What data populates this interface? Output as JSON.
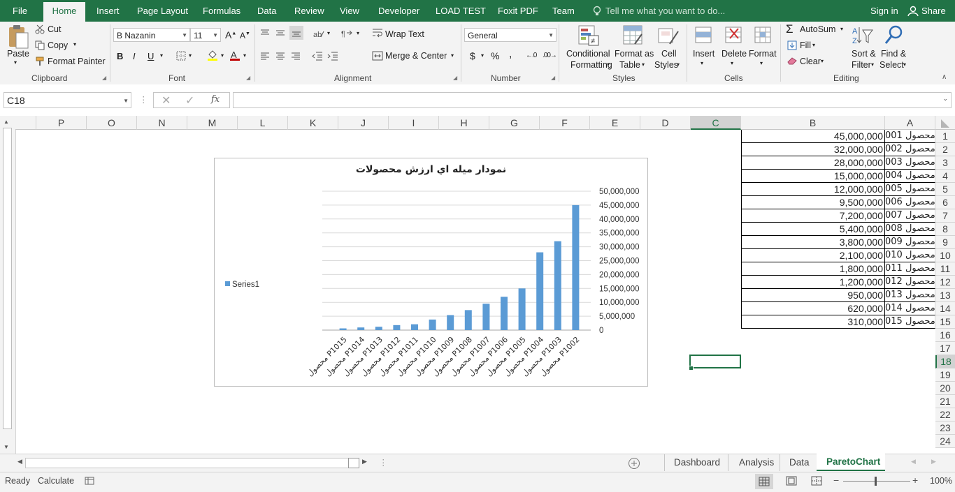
{
  "ribbon_tabs": [
    "File",
    "Home",
    "Insert",
    "Page Layout",
    "Formulas",
    "Data",
    "Review",
    "View",
    "Developer",
    "LOAD TEST",
    "Foxit PDF",
    "Team"
  ],
  "tell_me": "Tell me what you want to do...",
  "sign_in": "Sign in",
  "share": "Share",
  "clipboard": {
    "paste": "Paste",
    "cut": "Cut",
    "copy": "Copy",
    "format_painter": "Format Painter",
    "label": "Clipboard"
  },
  "font": {
    "name": "B Nazanin",
    "size": "11",
    "bold": "B",
    "italic": "I",
    "underline": "U",
    "label": "Font"
  },
  "alignment": {
    "wrap_text": "Wrap Text",
    "merge_center": "Merge & Center",
    "label": "Alignment"
  },
  "number": {
    "format": "General",
    "currency": "$",
    "percent": "%",
    "comma": ",",
    "label": "Number"
  },
  "styles": {
    "conditional_1": "Conditional",
    "conditional_2": "Formatting",
    "format_table_1": "Format as",
    "format_table_2": "Table",
    "cell_styles_1": "Cell",
    "cell_styles_2": "Styles",
    "label": "Styles"
  },
  "cells": {
    "insert": "Insert",
    "delete": "Delete",
    "format": "Format",
    "label": "Cells"
  },
  "editing": {
    "autosum": "AutoSum",
    "fill": "Fill",
    "clear": "Clear",
    "sort_1": "Sort &",
    "sort_2": "Filter",
    "find_1": "Find &",
    "find_2": "Select",
    "label": "Editing"
  },
  "formula_bar": {
    "name_box": "C18",
    "fx": "fx",
    "formula": ""
  },
  "columns": [
    "P",
    "O",
    "N",
    "M",
    "L",
    "K",
    "J",
    "I",
    "H",
    "G",
    "F",
    "E",
    "D",
    "C",
    "B",
    "A"
  ],
  "rows": [
    "1",
    "2",
    "3",
    "4",
    "5",
    "6",
    "7",
    "8",
    "9",
    "10",
    "11",
    "12",
    "13",
    "14",
    "15",
    "16",
    "17",
    "18",
    "19",
    "20",
    "21",
    "22",
    "23",
    "24"
  ],
  "table": {
    "col_a": [
      "محصول 001",
      "محصول 002",
      "محصول 003",
      "محصول 004",
      "محصول 005",
      "محصول 006",
      "محصول 007",
      "محصول 008",
      "محصول 009",
      "محصول 010",
      "محصول 011",
      "محصول 012",
      "محصول 013",
      "محصول 014",
      "محصول 015"
    ],
    "col_b": [
      "45,000,000",
      "32,000,000",
      "28,000,000",
      "15,000,000",
      "12,000,000",
      "9,500,000",
      "7,200,000",
      "5,400,000",
      "3,800,000",
      "2,100,000",
      "1,800,000",
      "1,200,000",
      "950,000",
      "620,000",
      "310,000"
    ]
  },
  "chart_data": {
    "type": "bar",
    "title": "نمودار ميله اي ارزش محصولات",
    "categories": [
      "محصول P1015",
      "محصول P1014",
      "محصول P1013",
      "محصول P1012",
      "محصول P1011",
      "محصول P1010",
      "محصول P1009",
      "محصول P1008",
      "محصول P1007",
      "محصول P1006",
      "محصول P1005",
      "محصول P1004",
      "محصول P1003",
      "محصول P1002"
    ],
    "series": [
      {
        "name": "Series1",
        "values": [
          620000,
          950000,
          1200000,
          1800000,
          2100000,
          3800000,
          5400000,
          7200000,
          9500000,
          12000000,
          15000000,
          28000000,
          32000000,
          45000000
        ]
      }
    ],
    "y_ticks": [
      "0",
      "5,000,000",
      "10,000,000",
      "15,000,000",
      "20,000,000",
      "25,000,000",
      "30,000,000",
      "35,000,000",
      "40,000,000",
      "45,000,000",
      "50,000,000"
    ],
    "ylim": [
      0,
      50000000
    ],
    "y_axis_side": "right",
    "legend": "left",
    "grid": true,
    "bar_color": "#5b9bd5"
  },
  "sheet_tabs": [
    "Dashboard",
    "Analysis",
    "Data",
    "ParetoChart"
  ],
  "active_sheet": "ParetoChart",
  "status": {
    "ready": "Ready",
    "calculate": "Calculate",
    "zoom": "100%"
  },
  "colors": {
    "excel_green": "#217346",
    "ribbon_bg": "#f3f3f3"
  }
}
